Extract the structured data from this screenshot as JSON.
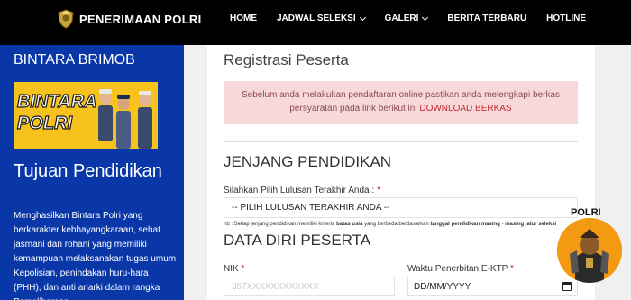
{
  "brand": {
    "name": "PENERIMAAN POLRI",
    "logo_icon": "police-emblem-icon"
  },
  "nav": [
    {
      "label": "HOME",
      "dropdown": false
    },
    {
      "label": "JADWAL SELEKSI",
      "dropdown": true
    },
    {
      "label": "GALERI",
      "dropdown": true
    },
    {
      "label": "BERITA TERBARU",
      "dropdown": false
    },
    {
      "label": "HOTLINE",
      "dropdown": false
    }
  ],
  "sidebar": {
    "title": "BINTARA BRIMOB",
    "banner_text": [
      "BINTARA",
      "POLRI"
    ],
    "heading": "Tujuan Pendidikan",
    "description": "Menghasilkan Bintara Polri yang berkarakter kebhayangkaraan, sehat jasmani dan rohani yang memiliki kemampuan melaksanakan tugas umum Kepolisian, penindakan huru-hara (PHH), dan anti anarki dalam rangka Pemeliharaan"
  },
  "form": {
    "title": "Registrasi Peserta",
    "alert_text": "Sebelum anda melakukan pendaftaran online pastikan anda melengkapi berkas persyaratan pada link berikut ini",
    "alert_link": "DOWNLOAD BERKAS",
    "section_education": "JENJANG PENDIDIKAN",
    "education_label": "Silahkan Pilih Lulusan Terakhir Anda :",
    "education_select_value": "-- PILIH LULUSAN TERAKHIR ANDA --",
    "note_prefix": "nb : Setiap jenjang pendidikan memiliki kriteria ",
    "note_bold1": "batas usia",
    "note_middle": " yang berbeda berdasarkan ",
    "note_bold2": "tanggal pendidikan masing - masing jalur seleksi",
    "section_personal": "DATA DIRI PESERTA",
    "nik_label": "NIK",
    "nik_placeholder": "357XXXXXXXXXXXX",
    "ktp_label": "Waktu Penerbitan E-KTP",
    "ktp_value": "DD/MM/YYYY",
    "required_mark": "*"
  },
  "floating_badge": {
    "label": "POLRI"
  },
  "colors": {
    "topbar": "#000000",
    "sidebar": "#0a37a8",
    "alert_bg": "#f7d9dc",
    "required": "#c7262f",
    "badge": "#f39a12",
    "banner": "#f6c21b"
  }
}
